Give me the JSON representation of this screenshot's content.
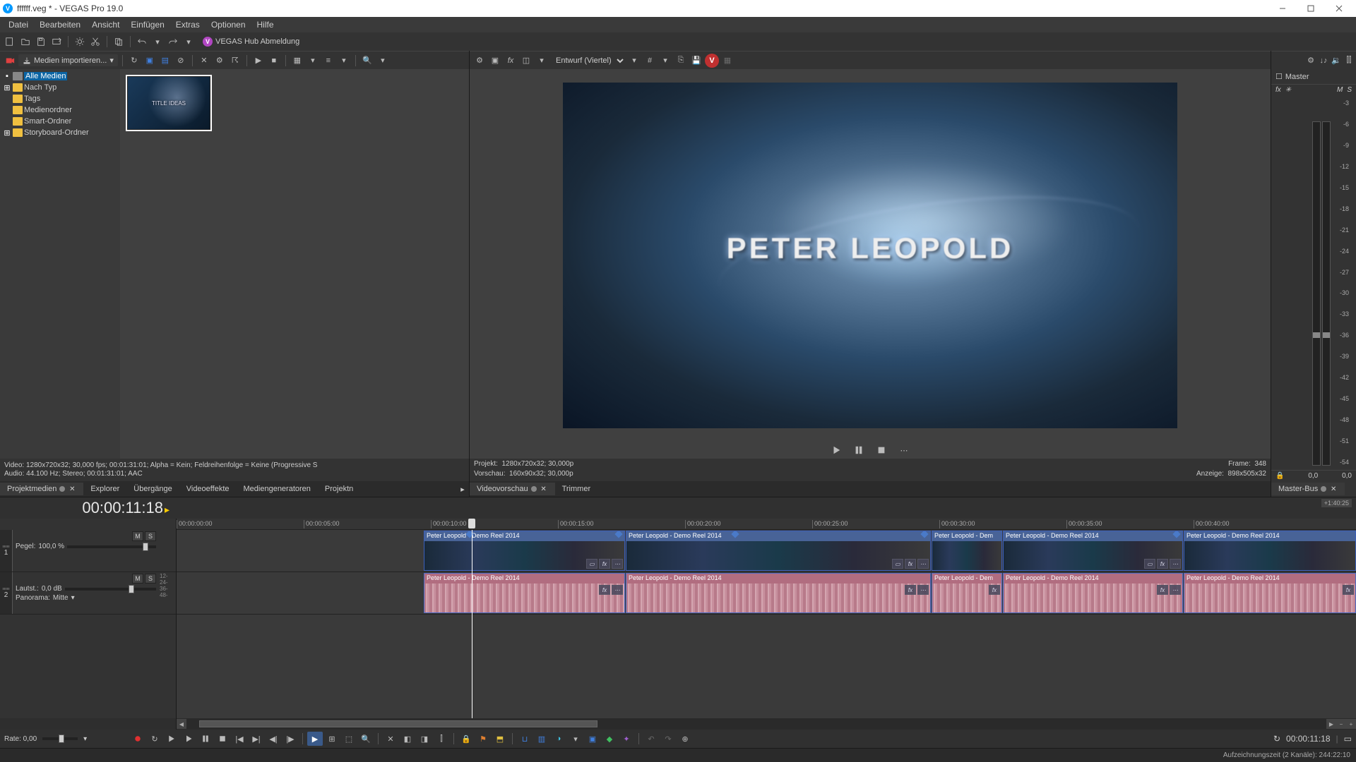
{
  "window": {
    "title": "ffffff.veg * - VEGAS Pro 19.0",
    "min": "—",
    "max": "▢",
    "close": "✕"
  },
  "menu": [
    "Datei",
    "Bearbeiten",
    "Ansicht",
    "Einfügen",
    "Extras",
    "Optionen",
    "Hilfe"
  ],
  "hub_label": "VEGAS Hub Abmeldung",
  "media": {
    "import_label": "Medien importieren...",
    "tree": {
      "all": "Alle Medien",
      "bytype": "Nach Typ",
      "tags": "Tags",
      "mediafolders": "Medienordner",
      "smart": "Smart-Ordner",
      "storyboard": "Storyboard-Ordner"
    },
    "thumb_text": "TITLE IDEAS",
    "info_video": "Video:  1280x720x32; 30,000 fps; 00:01:31:01; Alpha = Kein; Feldreihenfolge = Keine (Progressive S",
    "info_audio": "Audio:  44.100 Hz; Stereo; 00:01:31:01; AAC",
    "tabs": {
      "projektmedien": "Projektmedien",
      "explorer": "Explorer",
      "uebergaenge": "Übergänge",
      "videoeffekte": "Videoeffekte",
      "mediengen": "Mediengeneratoren",
      "projektnotizen": "Projektn"
    }
  },
  "preview": {
    "quality": "Entwurf (Viertel)",
    "overlay_text": "PETER LEOPOLD",
    "projekt_label": "Projekt:",
    "projekt_val": "1280x720x32; 30,000p",
    "vorschau_label": "Vorschau:",
    "vorschau_val": "160x90x32; 30,000p",
    "frame_label": "Frame:",
    "frame_val": "348",
    "anzeige_label": "Anzeige:",
    "anzeige_val": "898x505x32",
    "tabs": {
      "videovorschau": "Videovorschau",
      "trimmer": "Trimmer"
    }
  },
  "master": {
    "title": "Master",
    "M": "M",
    "S": "S",
    "fx": "fx",
    "scale": [
      "-3",
      "-6",
      "-9",
      "-12",
      "-15",
      "-18",
      "-21",
      "-24",
      "-27",
      "-30",
      "-33",
      "-36",
      "-39",
      "-42",
      "-45",
      "-48",
      "-51",
      "-54"
    ],
    "foot_l": "0,0",
    "foot_r": "0,0",
    "tab": "Master-Bus"
  },
  "timeline": {
    "timecode": "00:00:11:18",
    "zoomlevel": "+1:40:25",
    "ruler": [
      "00:00:00:00",
      "00:00:05:00",
      "00:00:10:00",
      "00:00:15:00",
      "00:00:20:00",
      "00:00:25:00",
      "00:00:30:00",
      "00:00:35:00",
      "00:00:40:00"
    ],
    "track1": {
      "M": "M",
      "S": "S",
      "pegel_label": "Pegel:",
      "pegel_val": "100,0 %"
    },
    "track2": {
      "M": "M",
      "S": "S",
      "laut_label": "Lautst.:",
      "laut_val": "0,0 dB",
      "pan_label": "Panorama:",
      "pan_val": "Mitte",
      "dbscale": [
        "12-",
        "24-",
        "36-",
        "48-"
      ]
    },
    "clip_name": "Peter Leopold - Demo Reel 2014",
    "clip_name_short": "Peter Leopold - Dem",
    "clip_fx": "fx",
    "clip_crop": "▭",
    "clip_more": "⋯",
    "rate_label": "Rate: 0,00",
    "right_time": "00:00:11:18"
  },
  "status": "Aufzeichnungszeit (2 Kanäle): 244:22:10",
  "icons": {
    "lock": "🔒"
  }
}
